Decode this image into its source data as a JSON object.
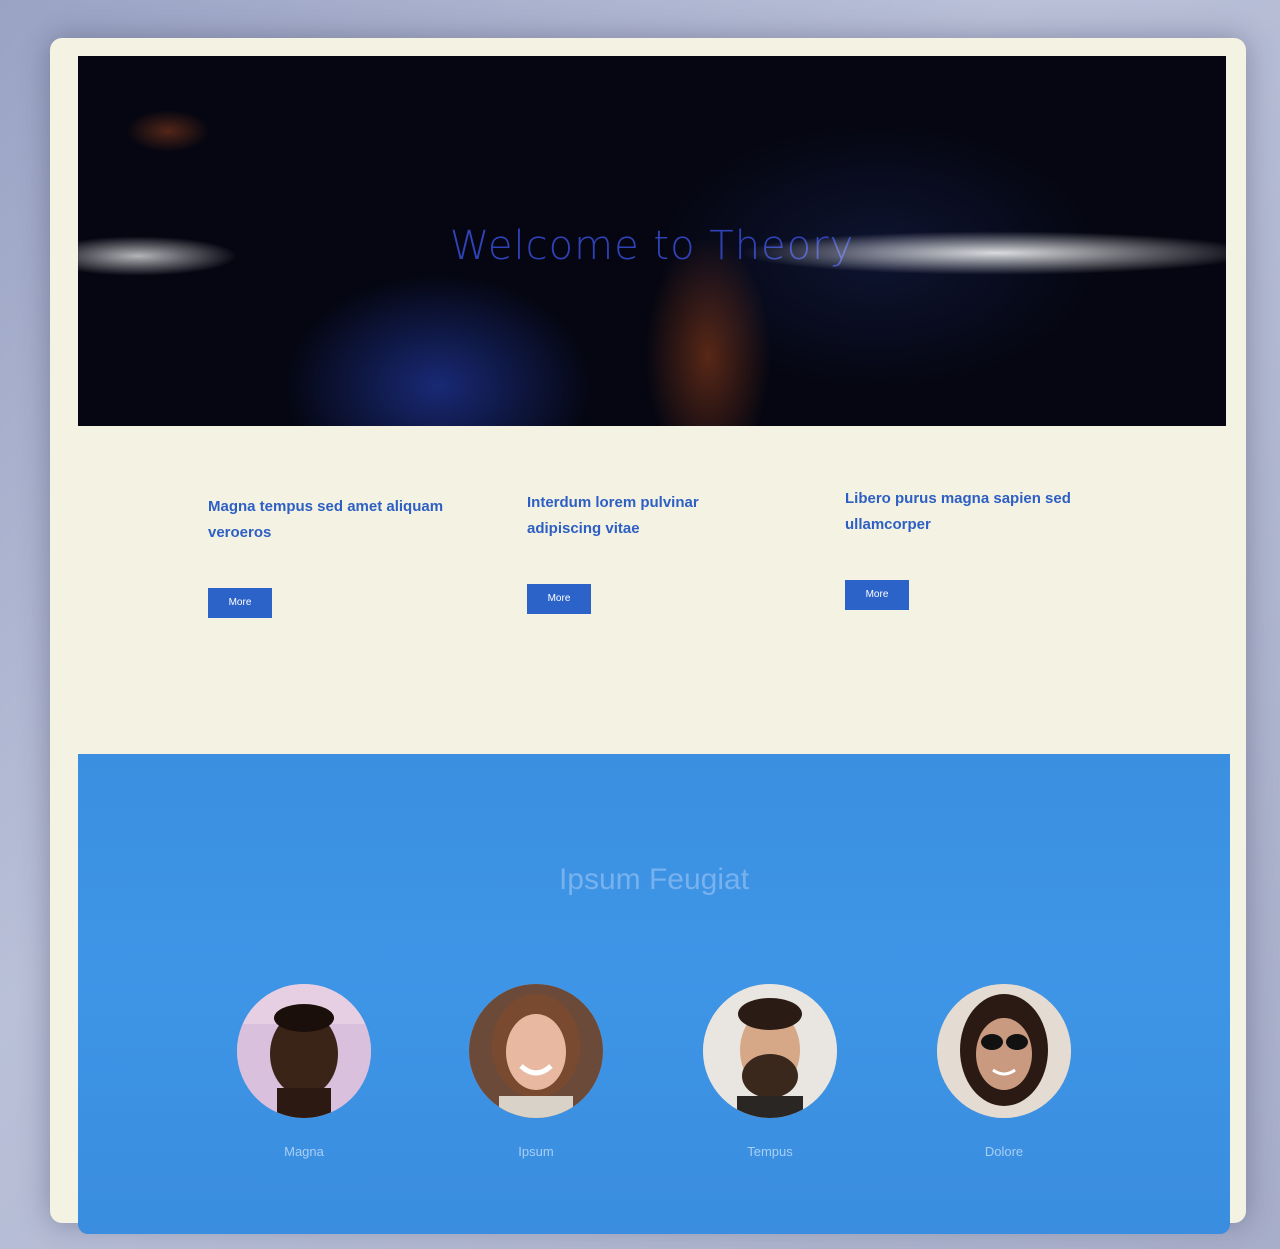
{
  "hero": {
    "logo": "",
    "title": "Welcome to Theory",
    "subtitle": ""
  },
  "features": [
    {
      "heading": "Magna tempus sed amet aliquam veroeros",
      "text": "",
      "button": "More"
    },
    {
      "heading": "Interdum lorem pulvinar adipiscing vitae",
      "text": "",
      "button": "More"
    },
    {
      "heading": "Libero purus magna sapien sed ullamcorper",
      "text": "",
      "button": "More"
    }
  ],
  "team": {
    "title": "Ipsum Feugiat",
    "subtitle": "",
    "members": [
      {
        "name": "Magna",
        "role": ""
      },
      {
        "name": "Ipsum",
        "role": ""
      },
      {
        "name": "Tempus",
        "role": ""
      },
      {
        "name": "Dolore",
        "role": ""
      }
    ]
  },
  "colors": {
    "accent": "#2c63c8",
    "team_bg": "#3b8fe0",
    "hero_bg": "#050611"
  }
}
